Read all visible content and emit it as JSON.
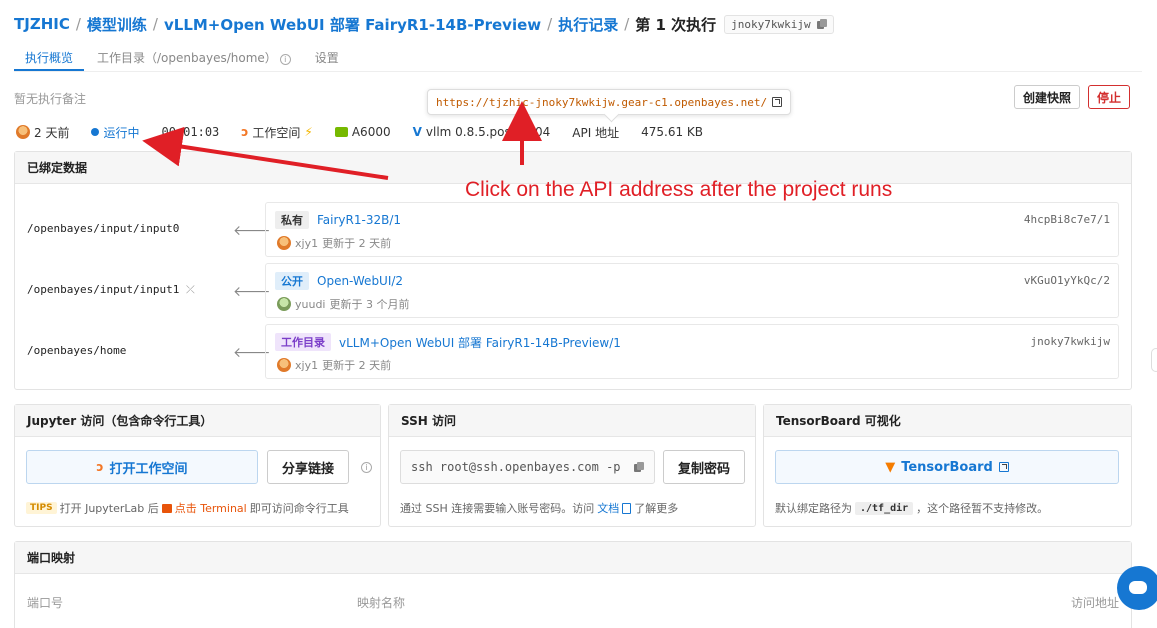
{
  "breadcrumb": {
    "items": [
      "TJZHIC",
      "模型训练",
      "vLLM+Open WebUI 部署 FairyR1-14B-Preview",
      "执行记录"
    ],
    "separator": "/",
    "current": "第 1 次执行",
    "exec_id": "jnoky7kwkijw"
  },
  "tabs": [
    {
      "label": "执行概览"
    },
    {
      "label": "工作目录（/openbayes/home）"
    },
    {
      "label": "设置"
    }
  ],
  "note": "暂无执行备注",
  "api_tooltip": "https://tjzhic-jnoky7kwkijw.gear-c1.openbayes.net/",
  "actions": {
    "snapshot": "创建快照",
    "stop": "停止"
  },
  "meta": {
    "created": "2 天前",
    "status": "运行中",
    "duration": "00:01:03",
    "workspace": "工作空间",
    "gpu": "A6000",
    "image": "vllm 0.8.5.post-2204",
    "api_label": "API 地址",
    "size": "475.61 KB"
  },
  "bound": {
    "title": "已绑定数据",
    "rows": [
      {
        "path": "/openbayes/input/input0",
        "tag": "私有",
        "tag_type": "private",
        "name": "FairyR1-32B/1",
        "hash": "4hcpBi8c7e7/1",
        "user": "xjy1",
        "updated": "更新于 2 天前",
        "avatar": "orange"
      },
      {
        "path": "/openbayes/input/input1",
        "tag": "公开",
        "tag_type": "public",
        "name": "Open-WebUI/2",
        "hash": "vKGuO1yYkQc/2",
        "user": "yuudi",
        "updated": "更新于 3 个月前",
        "avatar": "green"
      },
      {
        "path": "/openbayes/home",
        "tag": "工作目录",
        "tag_type": "workdir",
        "name": "vLLM+Open WebUI 部署 FairyR1-14B-Preview/1",
        "hash": "jnoky7kwkijw",
        "user": "xjy1",
        "updated": "更新于 2 天前",
        "avatar": "orange"
      }
    ]
  },
  "jupyter": {
    "title": "Jupyter 访问（包含命令行工具）",
    "open_btn": "打开工作空间",
    "share_btn": "分享链接",
    "tips_badge": "TIPS",
    "tips_pre": "打开 JupyterLab 后",
    "tips_link": "点击 Terminal",
    "tips_post": "即可访问命令行工具"
  },
  "ssh": {
    "title": "SSH 访问",
    "command": "ssh root@ssh.openbayes.com -p",
    "copy_pwd": "复制密码",
    "hint_pre": "通过 SSH 连接需要输入账号密码。访问",
    "hint_link": "文档",
    "hint_post": "了解更多"
  },
  "tensorboard": {
    "title": "TensorBoard 可视化",
    "btn": "TensorBoard",
    "hint_pre": "默认绑定路径为",
    "hint_code": "./tf_dir",
    "hint_post": "，这个路径暂不支持修改。"
  },
  "ports": {
    "title": "端口映射",
    "cols": [
      "端口号",
      "映射名称",
      "访问地址"
    ]
  },
  "annotation": {
    "text": "Click on the API address after the project runs",
    "color": "#e01f26"
  },
  "colors": {
    "accent": "#1677d2",
    "danger": "#d32f2f"
  }
}
